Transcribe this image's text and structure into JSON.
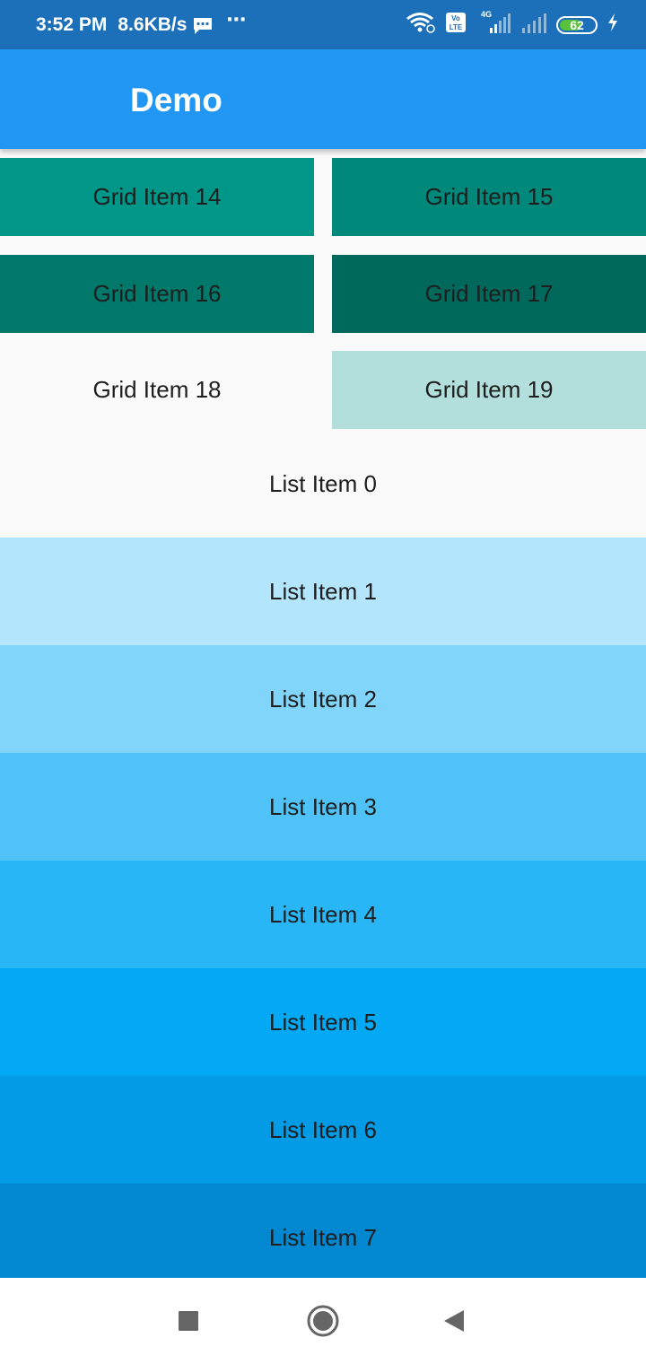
{
  "status_bar": {
    "time": "3:52 PM",
    "speed": "8.6KB/s",
    "more": "⋯",
    "network_label": "4G",
    "volte_label": "Vo LTE",
    "battery_level": "62",
    "battery_fraction": 0.62,
    "icons": [
      "message-icon",
      "wifi-icon",
      "volte-icon",
      "signal-icon",
      "signal-icon",
      "battery-icon",
      "charging-icon"
    ]
  },
  "app_bar": {
    "title": "Demo"
  },
  "grid_items": [
    {
      "label": "Grid Item 14",
      "color": "#009688"
    },
    {
      "label": "Grid Item 15",
      "color": "#00897b"
    },
    {
      "label": "Grid Item 16",
      "color": "#00796b"
    },
    {
      "label": "Grid Item 17",
      "color": "#00695c"
    },
    {
      "label": "Grid Item 18",
      "color": "#fafafa"
    },
    {
      "label": "Grid Item 19",
      "color": "#b2dfdb"
    }
  ],
  "list_items": [
    {
      "label": "List Item 0",
      "color": "#fafafa"
    },
    {
      "label": "List Item 1",
      "color": "#b3e5fc"
    },
    {
      "label": "List Item 2",
      "color": "#81d4fa"
    },
    {
      "label": "List Item 3",
      "color": "#4fc3f7"
    },
    {
      "label": "List Item 4",
      "color": "#29b6f6"
    },
    {
      "label": "List Item 5",
      "color": "#03a9f4"
    },
    {
      "label": "List Item 6",
      "color": "#039be5"
    },
    {
      "label": "List Item 7",
      "color": "#0288d1"
    }
  ],
  "nav_bar": {
    "buttons": [
      "recents-square-icon",
      "home-circle-icon",
      "back-triangle-icon"
    ]
  },
  "colors": {
    "status_bar": "#1c70b9",
    "app_bar": "#2196f3",
    "background": "#fafafa"
  }
}
